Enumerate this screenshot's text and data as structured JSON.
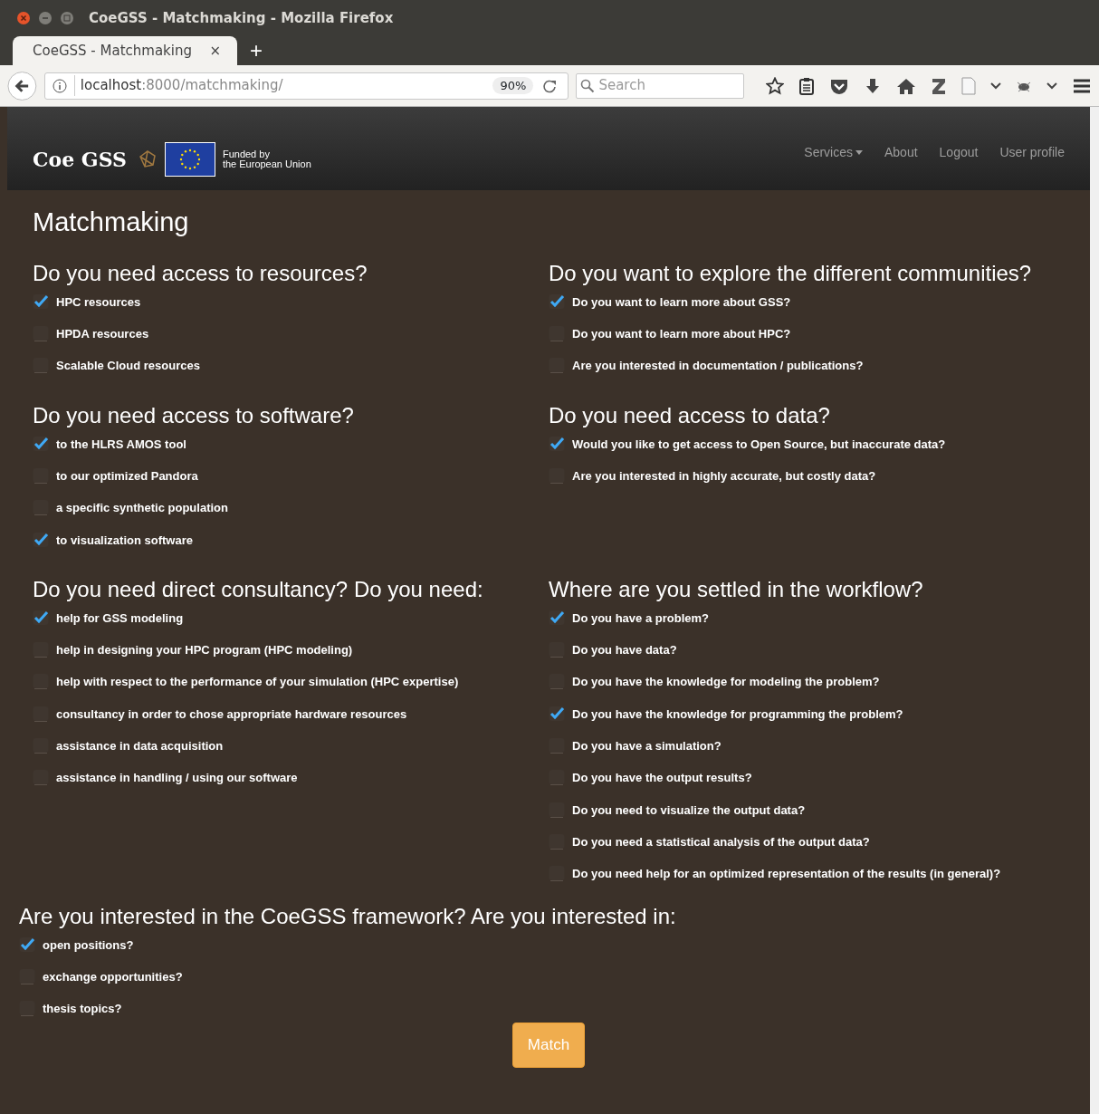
{
  "window": {
    "title": "CoeGSS - Matchmaking - Mozilla Firefox"
  },
  "tabs": [
    {
      "label": "CoeGSS - Matchmaking",
      "selected": true,
      "close": "×"
    }
  ],
  "new_tab": "+",
  "toolbar": {
    "url_host": "localhost",
    "url_path": ":8000/matchmaking/",
    "zoom": "90%",
    "search": {
      "placeholder": "Search"
    }
  },
  "site_nav": {
    "brand": "Coe GSS",
    "eu_text": [
      "Funded by",
      "the European Union"
    ],
    "links": [
      {
        "label": "Services",
        "kind": "dropdown"
      },
      {
        "label": "About",
        "kind": "link"
      },
      {
        "label": "Logout",
        "kind": "link"
      },
      {
        "label": "User profile",
        "kind": "link"
      }
    ]
  },
  "page_title": "Matchmaking",
  "sections": [
    {
      "title": "Do you need access to resources?",
      "items": [
        {
          "label": "HPC resources",
          "checked": true
        },
        {
          "label": "HPDA resources",
          "checked": false
        },
        {
          "label": "Scalable Cloud resources",
          "checked": false
        }
      ]
    },
    {
      "title": "Do you want to explore the different communities?",
      "items": [
        {
          "label": "Do you want to learn more about GSS?",
          "checked": true
        },
        {
          "label": "Do you want to learn more about HPC?",
          "checked": false
        },
        {
          "label": "Are you interested in documentation / publications?",
          "checked": false
        }
      ]
    },
    {
      "title": "Do you need access to software?",
      "items": [
        {
          "label": "to the HLRS AMOS tool",
          "checked": true
        },
        {
          "label": "to our optimized Pandora",
          "checked": false
        },
        {
          "label": "a specific synthetic population",
          "checked": false
        },
        {
          "label": "to visualization software",
          "checked": true
        }
      ]
    },
    {
      "title": "Do you need access to data?",
      "items": [
        {
          "label": "Would you like to get access to Open Source, but inaccurate data?",
          "checked": true
        },
        {
          "label": "Are you interested in highly accurate, but costly data?",
          "checked": false
        }
      ]
    },
    {
      "title": "Do you need direct consultancy? Do you need:",
      "items": [
        {
          "label": "help for GSS modeling",
          "checked": true
        },
        {
          "label": "help in designing your HPC program (HPC modeling)",
          "checked": false
        },
        {
          "label": "help with respect to the performance of your simulation (HPC expertise)",
          "checked": false
        },
        {
          "label": "consultancy in order to chose appropriate hardware resources",
          "checked": false
        },
        {
          "label": "assistance in data acquisition",
          "checked": false
        },
        {
          "label": "assistance in handling / using our software",
          "checked": false
        }
      ]
    },
    {
      "title": "Where are you settled in the workflow?",
      "items": [
        {
          "label": "Do you have a problem?",
          "checked": true
        },
        {
          "label": "Do you have data?",
          "checked": false
        },
        {
          "label": "Do you have the knowledge for modeling the problem?",
          "checked": false
        },
        {
          "label": "Do you have the knowledge for programming the problem?",
          "checked": true
        },
        {
          "label": "Do you have a simulation?",
          "checked": false
        },
        {
          "label": "Do you have the output results?",
          "checked": false
        },
        {
          "label": "Do you need to visualize the output data?",
          "checked": false
        },
        {
          "label": "Do you need a statistical analysis of the output data?",
          "checked": false
        },
        {
          "label": "Do you need help for an optimized representation of the results (in general)?",
          "checked": false
        }
      ]
    }
  ],
  "framework_section": {
    "title": "Are you interested in the CoeGSS framework? Are you interested in:",
    "items": [
      {
        "label": "open positions?",
        "checked": true
      },
      {
        "label": "exchange opportunities?",
        "checked": false
      },
      {
        "label": "thesis topics?",
        "checked": false
      }
    ]
  },
  "button": "Match"
}
